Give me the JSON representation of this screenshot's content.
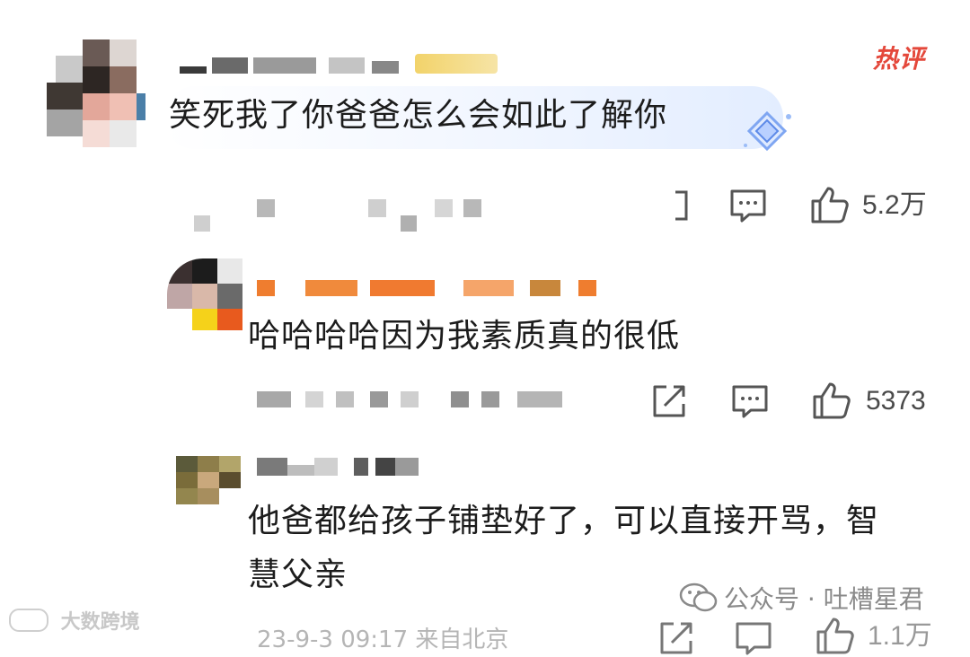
{
  "hot_badge": "热评",
  "comments": [
    {
      "text": "笑死我了你爸爸怎么会如此了解你",
      "likes": "5.2万"
    },
    {
      "text": "哈哈哈哈因为我素质真的很低",
      "likes": "5373"
    },
    {
      "text_line1": "他爸都给孩子铺垫好了，可以直接开骂，智",
      "text_line2": "慧父亲",
      "meta": "23-9-3 09:17 来自北京",
      "likes": "1.1万"
    }
  ],
  "watermark": {
    "right": "公众号 · 吐槽星君",
    "left": "大数跨境"
  },
  "colors": {
    "accent_red": "#e4483b",
    "icon_gray": "#555555",
    "blur_orange": "#f28a3c"
  },
  "icons": [
    "share-icon",
    "comment-icon",
    "like-icon",
    "badge-diamond-icon",
    "wechat-icon"
  ]
}
